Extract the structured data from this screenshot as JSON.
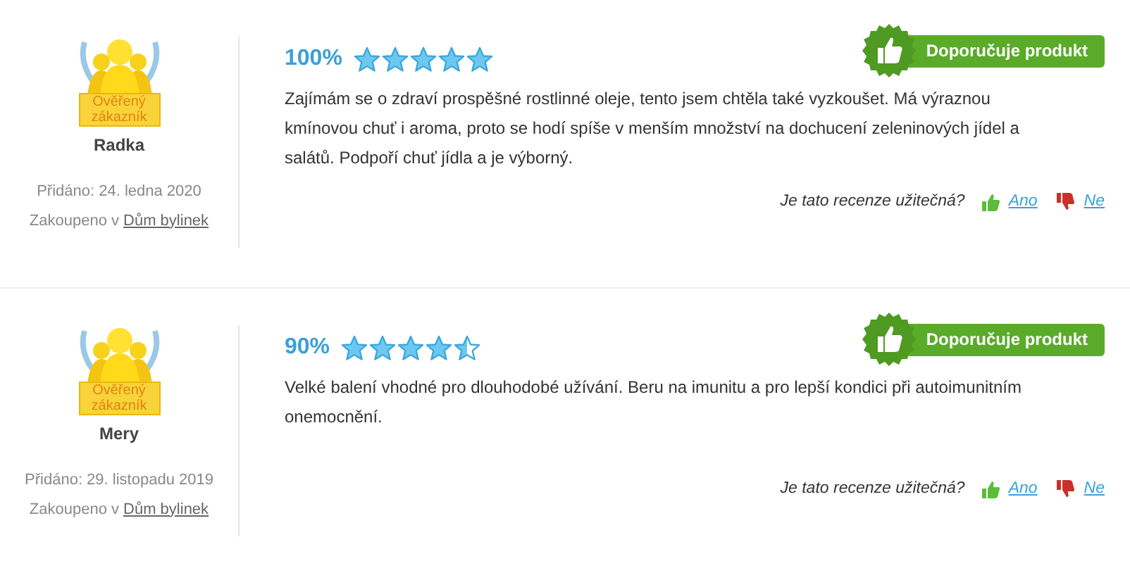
{
  "reviews": [
    {
      "badge": "Ověřený zákazník",
      "author": "Radka",
      "added": "Přidáno: 24. ledna 2020",
      "bought_prefix": "Zakoupeno v",
      "shop": "Dům bylinek",
      "percent": "100%",
      "stars": 5,
      "recommend": "Doporučuje produkt",
      "text": "Zajímám se o zdraví prospěšné rostlinné oleje, tento jsem chtěla také vyzkoušet. Má výraznou kmínovou chuť i aroma, proto se hodí spíše v menším množství na dochucení zeleninových jídel a salátů. Podpoří chuť jídla a je výborný.",
      "helpful_question": "Je tato recenze užitečná?",
      "yes": "Ano",
      "no": "Ne"
    },
    {
      "badge": "Ověřený zákazník",
      "author": "Mery",
      "added": "Přidáno: 29. listopadu 2019",
      "bought_prefix": "Zakoupeno v",
      "shop": "Dům bylinek",
      "percent": "90%",
      "stars": 4.5,
      "recommend": "Doporučuje produkt",
      "text": "Velké balení vhodné pro dlouhodobé užívání. Beru na imunitu a pro lepší kondici při autoimunitním onemocnění.",
      "helpful_question": "Je tato recenze užitečná?",
      "yes": "Ano",
      "no": "Ne"
    }
  ]
}
